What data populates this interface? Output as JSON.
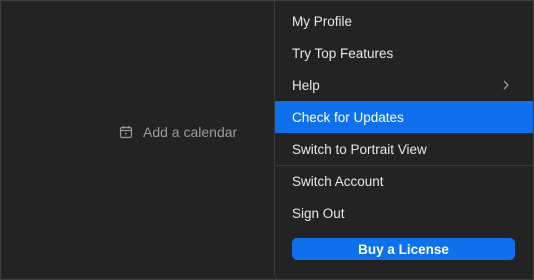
{
  "calendar_panel": {
    "add_calendar_label": "Add a calendar",
    "icon": "calendar-icon"
  },
  "menu": {
    "items": [
      {
        "label": "My Profile"
      },
      {
        "label": "Try Top Features"
      },
      {
        "label": "Help",
        "icon": "chevron-right-icon"
      },
      {
        "label": "Check for Updates",
        "active": true
      },
      {
        "label": "Switch to Portrait View"
      },
      {
        "label": "Switch Account"
      },
      {
        "label": "Sign Out"
      }
    ],
    "buy_button_label": "Buy a License"
  },
  "colors": {
    "background": "#262626",
    "menu_background": "#232323",
    "accent": "#0e71eb",
    "text": "#e8e8e8",
    "muted_text": "#9a9a9a"
  }
}
